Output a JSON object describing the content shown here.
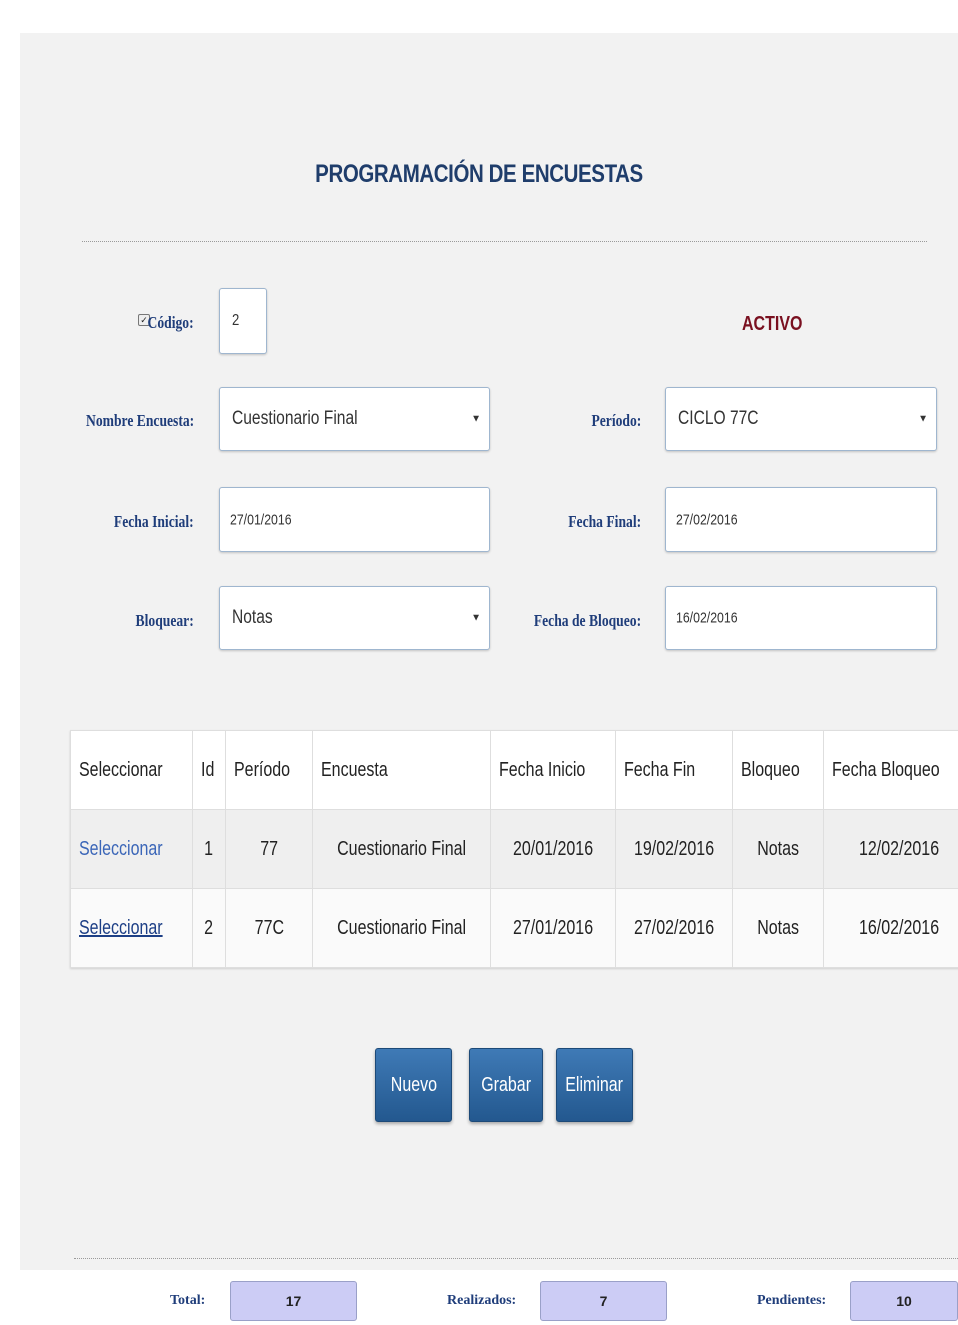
{
  "page_title": "PROGRAMACIÓN DE ENCUESTAS",
  "form": {
    "codigo_label": "Código:",
    "codigo_value": "2",
    "status": "ACTIVO",
    "nombre_label": "Nombre Encuesta:",
    "nombre_value": "Cuestionario Final",
    "periodo_label": "Período:",
    "periodo_value": "CICLO 77C",
    "fecha_inicial_label": "Fecha Inicial:",
    "fecha_inicial_value": "27/01/2016",
    "fecha_final_label": "Fecha Final:",
    "fecha_final_value": "27/02/2016",
    "bloquear_label": "Bloquear:",
    "bloquear_value": "Notas",
    "fecha_bloqueo_label": "Fecha de Bloqueo:",
    "fecha_bloqueo_value": "16/02/2016"
  },
  "table": {
    "headers": [
      "Seleccionar",
      "Id",
      "Período",
      "Encuesta",
      "Fecha Inicio",
      "Fecha Fin",
      "Bloqueo",
      "Fecha Bloqueo"
    ],
    "rows": [
      [
        "Seleccionar",
        "1",
        "77",
        "Cuestionario Final",
        "20/01/2016",
        "19/02/2016",
        "Notas",
        "12/02/2016"
      ],
      [
        "Seleccionar",
        "2",
        "77C",
        "Cuestionario Final",
        "27/01/2016",
        "27/02/2016",
        "Notas",
        "16/02/2016"
      ]
    ]
  },
  "buttons": {
    "nuevo": "Nuevo",
    "grabar": "Grabar",
    "eliminar": "Eliminar"
  },
  "footer": {
    "total_label": "Total:",
    "total_value": "17",
    "realizados_label": "Realizados:",
    "realizados_value": "7",
    "pendientes_label": "Pendientes:",
    "pendientes_value": "10"
  },
  "colors": {
    "title": "#1f3d6b",
    "label": "#1f3d7a",
    "status": "#7a1020",
    "button": "#2d6aa3",
    "counter_bg": "#ccccf5"
  }
}
